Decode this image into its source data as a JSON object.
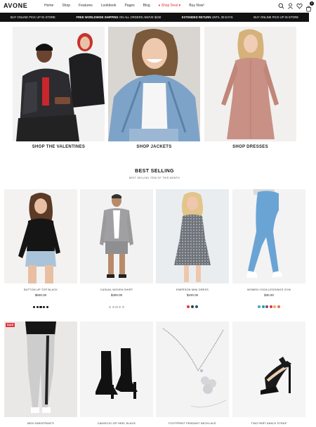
{
  "header": {
    "logo": "AVONE",
    "nav": [
      "Home",
      "Shop",
      "Features",
      "Lookbook",
      "Pages",
      "Blog",
      "Shop Deal",
      "Buy Now!"
    ],
    "cart_count": "0"
  },
  "promo": {
    "left": "BUY ONLINE PICK UP IN STORE",
    "free_bold": "FREE WORLDWIDE SHIPPING",
    "free_rest": " ON ALL ORDERS ABOVE $100",
    "ret_bold": "EXTENDED RETURN",
    "ret_rest": " UNTIL 30 DAYS",
    "right": "BUY ONLINE PICK UP IN STORE"
  },
  "categories": [
    {
      "label": "SHOP THE VALENTINES"
    },
    {
      "label": "SHOP JACKETS"
    },
    {
      "label": "SHOP DRESSES"
    }
  ],
  "best": {
    "title": "BEST SELLING",
    "subtitle": "BEST SELLING ITEM OF THIS MONTH"
  },
  "products": [
    {
      "name": "BUTTON UP TOP BLACK",
      "price": "$600.00",
      "rating": 5
    },
    {
      "name": "CASUAL WOVEN SHIRT",
      "price": "$300.00",
      "rating": 0
    },
    {
      "name": "EMERSON MINI DRESS",
      "price": "$100.00",
      "rating": 0,
      "swatches": [
        "#e4333e",
        "#2c3e50",
        "#1a5f6a"
      ]
    },
    {
      "name": "WOMEN YOGA LEGGINGS GYM",
      "price": "$30.00",
      "rating": 0,
      "swatches": [
        "#4aa3c9",
        "#2a9d8f",
        "#6a4c93",
        "#e4333e",
        "#f4a261",
        "#e76f51"
      ]
    },
    {
      "name": "MEN SWEATPANTS",
      "badge": "SALE"
    },
    {
      "name": "CAMISCIO ZIP HEEL BLACK"
    },
    {
      "name": "FOOTPRINT PENDANT NECKLACE"
    },
    {
      "name": "TWO PART ANKLE STRAP"
    }
  ]
}
